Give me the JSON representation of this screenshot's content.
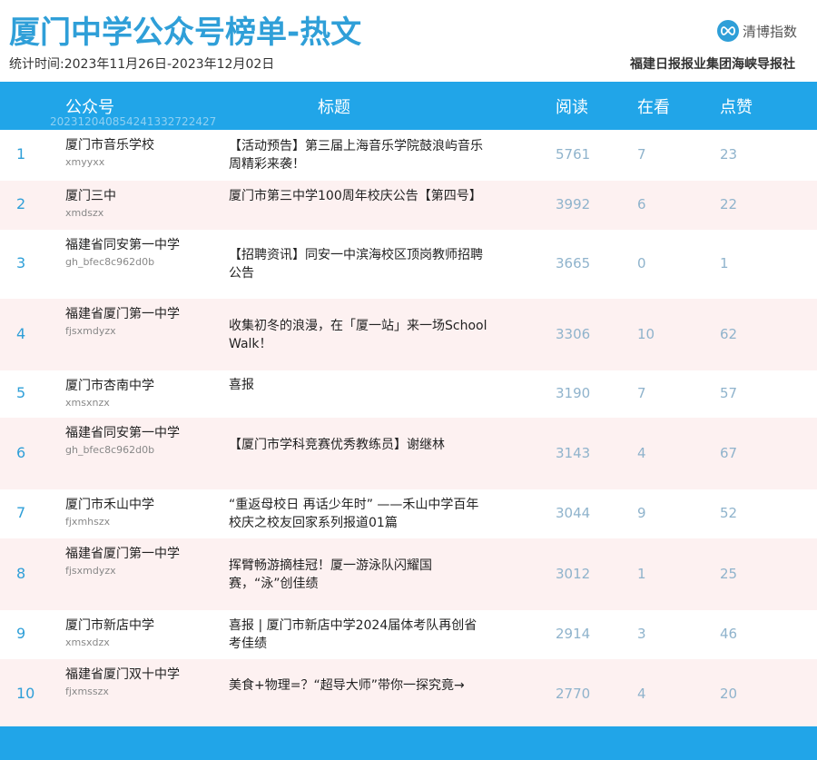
{
  "header": {
    "title": "厦门中学公众号榜单-热文",
    "period": "统计时间:2023年11月26日-2023年12月02日",
    "brand_name": "清博指数",
    "org": "福建日报报业集团海峡导报社"
  },
  "table": {
    "columns": [
      "公众号",
      "标题",
      "阅读",
      "在看",
      "点赞"
    ],
    "watermark": "20231204085424133272242​7",
    "rows": [
      {
        "rank": "1",
        "name": "厦门市音乐学校",
        "id": "xmyyxx",
        "title": "【活动预告】第三届上海音乐学院鼓浪屿音乐周精彩来袭！",
        "reads": "5761",
        "views": "7",
        "likes": "23"
      },
      {
        "rank": "2",
        "name": "厦门三中",
        "id": "xmdszx",
        "title": "厦门市第三中学100周年校庆公告【第四号】",
        "reads": "3992",
        "views": "6",
        "likes": "22"
      },
      {
        "rank": "3",
        "name": "福建省同安第一中学",
        "id": "gh_bfec8c962d0b",
        "title": "【招聘资讯】同安一中滨海校区顶岗教师招聘公告",
        "reads": "3665",
        "views": "0",
        "likes": "1"
      },
      {
        "rank": "4",
        "name": "福建省厦门第一中学",
        "id": "fjsxmdyzx",
        "title": "收集初冬的浪漫，在「厦一站」来一场School Walk！",
        "reads": "3306",
        "views": "10",
        "likes": "62"
      },
      {
        "rank": "5",
        "name": "厦门市杏南中学",
        "id": "xmsxnzx",
        "title": "喜报",
        "reads": "3190",
        "views": "7",
        "likes": "57"
      },
      {
        "rank": "6",
        "name": "福建省同安第一中学",
        "id": "gh_bfec8c962d0b",
        "title": "【厦门市学科竞赛优秀教练员】谢继林",
        "reads": "3143",
        "views": "4",
        "likes": "67"
      },
      {
        "rank": "7",
        "name": "厦门市禾山中学",
        "id": "fjxmhszx",
        "title": "“重返母校日 再话少年时” ——禾山中学百年校庆之校友回家系列报道01篇",
        "reads": "3044",
        "views": "9",
        "likes": "52"
      },
      {
        "rank": "8",
        "name": "福建省厦门第一中学",
        "id": "fjsxmdyzx",
        "title": "挥臂畅游摘桂冠！厦一游泳队闪耀国赛，“泳”创佳绩",
        "reads": "3012",
        "views": "1",
        "likes": "25"
      },
      {
        "rank": "9",
        "name": "厦门市新店中学",
        "id": "xmsxdzx",
        "title": "喜报 | 厦门市新店中学2024届体考队再创省考佳绩",
        "reads": "2914",
        "views": "3",
        "likes": "46"
      },
      {
        "rank": "10",
        "name": "福建省厦门双十中学",
        "id": "fjxmsszx",
        "title": "美食+物理=？“超导大师”带你一探究竟→",
        "reads": "2770",
        "views": "4",
        "likes": "20"
      }
    ]
  }
}
